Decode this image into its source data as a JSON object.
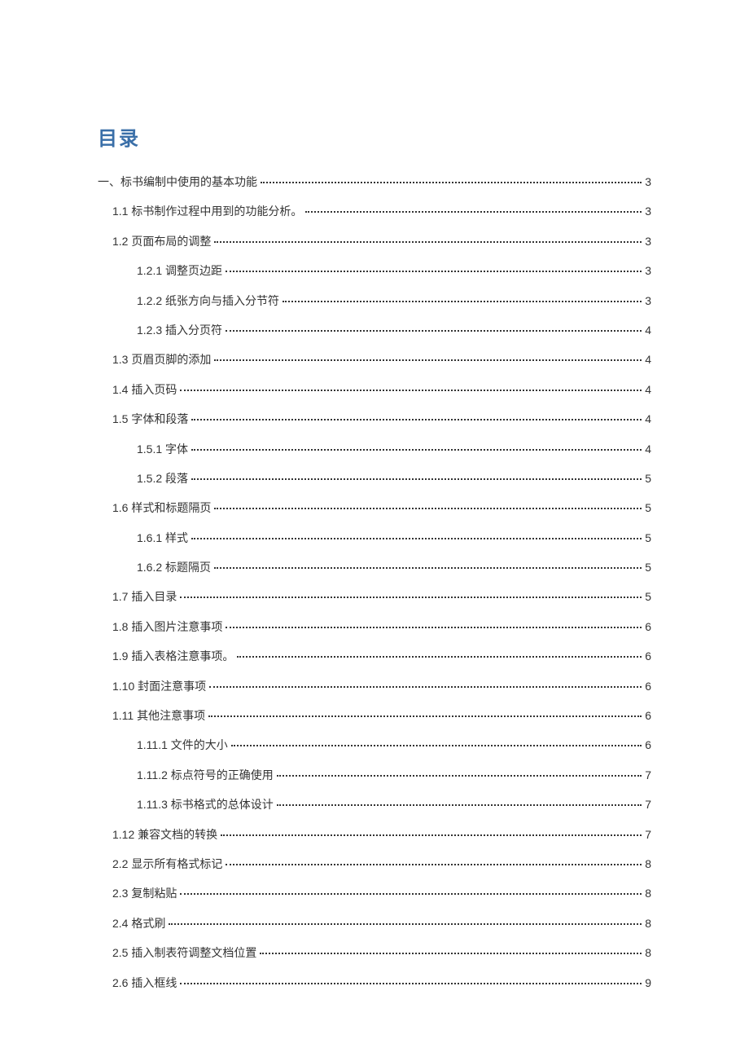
{
  "title": "目录",
  "entries": [
    {
      "level": 0,
      "label": "一、标书编制中使用的基本功能",
      "page": "3"
    },
    {
      "level": 1,
      "label": "1.1 标书制作过程中用到的功能分析。",
      "page": "3"
    },
    {
      "level": 1,
      "label": "1.2 页面布局的调整",
      "page": "3"
    },
    {
      "level": 2,
      "label": "1.2.1 调整页边距",
      "page": "3"
    },
    {
      "level": 2,
      "label": "1.2.2 纸张方向与插入分节符",
      "page": "3"
    },
    {
      "level": 2,
      "label": "1.2.3 插入分页符",
      "page": "4"
    },
    {
      "level": 1,
      "label": "1.3 页眉页脚的添加",
      "page": "4"
    },
    {
      "level": 1,
      "label": "1.4 插入页码",
      "page": "4"
    },
    {
      "level": 1,
      "label": "1.5 字体和段落",
      "page": "4"
    },
    {
      "level": 2,
      "label": "1.5.1 字体",
      "page": "4"
    },
    {
      "level": 2,
      "label": "1.5.2 段落",
      "page": "5"
    },
    {
      "level": 1,
      "label": "1.6 样式和标题隔页",
      "page": "5"
    },
    {
      "level": 2,
      "label": "1.6.1 样式",
      "page": "5"
    },
    {
      "level": 2,
      "label": "1.6.2 标题隔页",
      "page": "5"
    },
    {
      "level": 1,
      "label": "1.7 插入目录",
      "page": "5"
    },
    {
      "level": 1,
      "label": "1.8 插入图片注意事项",
      "page": "6"
    },
    {
      "level": 1,
      "label": "1.9 插入表格注意事项。",
      "page": "6"
    },
    {
      "level": 1,
      "label": "1.10 封面注意事项",
      "page": "6"
    },
    {
      "level": 1,
      "label": "1.11 其他注意事项",
      "page": "6"
    },
    {
      "level": 2,
      "label": "1.11.1 文件的大小",
      "page": "6"
    },
    {
      "level": 2,
      "label": "1.11.2 标点符号的正确使用",
      "page": "7"
    },
    {
      "level": 2,
      "label": "1.11.3 标书格式的总体设计",
      "page": "7"
    },
    {
      "level": 1,
      "label": "1.12 兼容文档的转换",
      "page": "7"
    },
    {
      "level": 1,
      "label": "2.2 显示所有格式标记",
      "page": "8"
    },
    {
      "level": 1,
      "label": "2.3 复制粘贴",
      "page": "8"
    },
    {
      "level": 1,
      "label": "2.4 格式刷",
      "page": "8"
    },
    {
      "level": 1,
      "label": "2.5 插入制表符调整文档位置",
      "page": "8"
    },
    {
      "level": 1,
      "label": "2.6 插入框线",
      "page": "9"
    }
  ]
}
